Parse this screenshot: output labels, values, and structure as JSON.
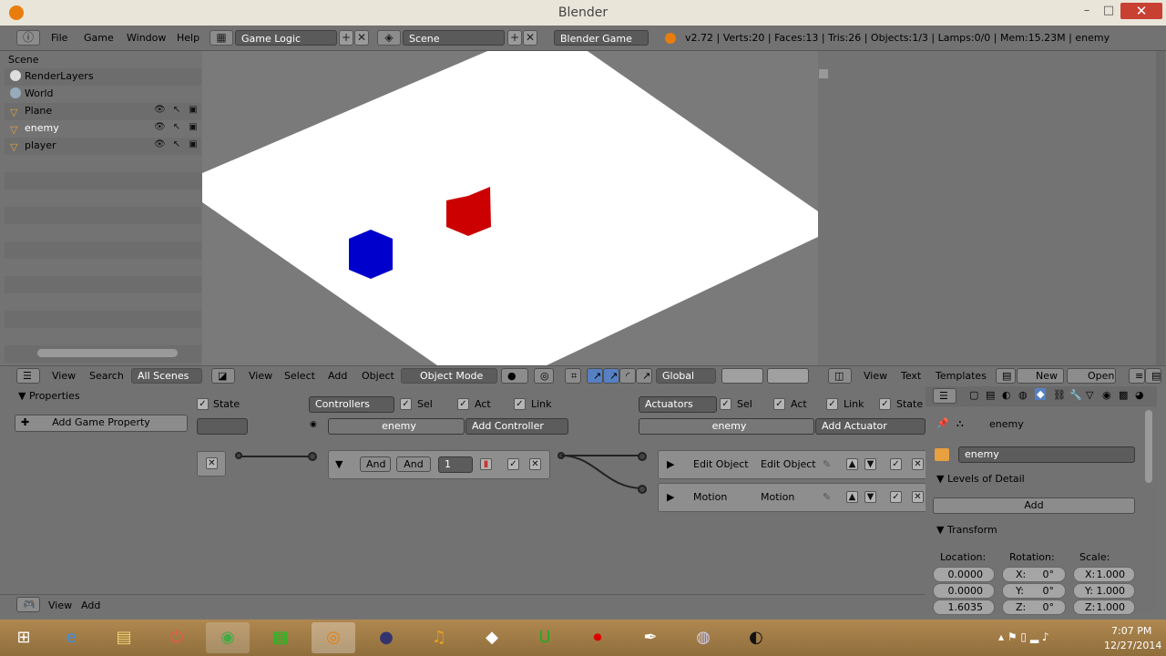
{
  "window": {
    "title": "Blender",
    "min": "–",
    "max": "□",
    "close": "✕"
  },
  "menu": [
    "File",
    "Game",
    "Window",
    "Help"
  ],
  "header": {
    "screen_layout": "Game Logic",
    "scene": "Scene",
    "engine": "Blender Game",
    "stats": "v2.72 | Verts:20 | Faces:13 | Tris:26 | Objects:1/3 | Lamps:0/0 | Mem:15.23M | enemy"
  },
  "outliner": {
    "root": "Scene",
    "items": [
      {
        "label": "RenderLayers"
      },
      {
        "label": "World"
      },
      {
        "label": "Plane"
      },
      {
        "label": "enemy"
      },
      {
        "label": "player"
      }
    ],
    "footer": [
      "View",
      "Search",
      "All Scenes"
    ]
  },
  "viewport_header": {
    "menus": [
      "View",
      "Select",
      "Add",
      "Object"
    ],
    "mode": "Object Mode",
    "orientation": "Global"
  },
  "text_header": {
    "menus": [
      "View",
      "Text",
      "Templates"
    ],
    "new": "New",
    "open": "Open"
  },
  "logic": {
    "properties_title": "Properties",
    "add_game_property": "Add Game Property",
    "state_label": "State",
    "controllers_label": "Controllers",
    "sel": "Sel",
    "act": "Act",
    "link": "Link",
    "object_name": "enemy",
    "add_controller": "Add Controller",
    "actuators_label": "Actuators",
    "add_actuator": "Add Actuator",
    "controller": {
      "type": "And",
      "name": "And",
      "state": "1"
    },
    "actuators": [
      {
        "type": "Edit Object",
        "name": "Edit Object"
      },
      {
        "type": "Motion",
        "name": "Motion"
      }
    ],
    "footer": [
      "View",
      "Add"
    ]
  },
  "properties": {
    "context_object": "enemy",
    "object_name": "enemy",
    "panels": [
      "Levels of Detail",
      "Transform"
    ],
    "lod_add": "Add",
    "location_label": "Location:",
    "rotation_label": "Rotation:",
    "scale_label": "Scale:",
    "location": [
      "0.0000",
      "0.0000",
      "1.6035"
    ],
    "rotation": [
      {
        "axis": "X:",
        "value": "0°"
      },
      {
        "axis": "Y:",
        "value": "0°"
      },
      {
        "axis": "Z:",
        "value": "0°"
      }
    ],
    "scale": [
      {
        "axis": "X:",
        "value": "1.000"
      },
      {
        "axis": "Y:",
        "value": "1.000"
      },
      {
        "axis": "Z:",
        "value": "1.000"
      }
    ]
  },
  "taskbar": {
    "time": "7:07 PM",
    "date": "12/27/2014"
  },
  "colors": {
    "red_cube": "#cc0000",
    "blue_cube": "#0000cc",
    "plane": "#ffffff"
  }
}
